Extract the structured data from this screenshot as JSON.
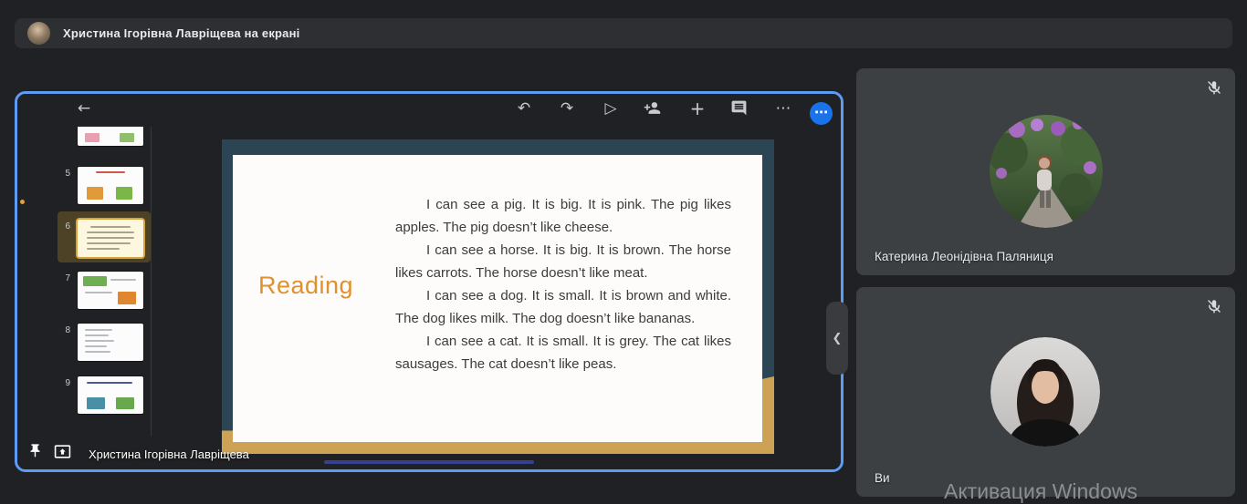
{
  "banner": {
    "text": "Христина Ігорівна Лавріщева на екрані"
  },
  "share": {
    "presenter_label": "Христина Ігорівна Лавріщева",
    "toolbar": {
      "back_glyph": "←",
      "undo_glyph": "↶",
      "redo_glyph": "↷",
      "present_glyph": "▷",
      "insert_glyph": "+",
      "more_glyph": "⋯",
      "overflow_glyph": "⋯"
    },
    "handle_glyph": "❮",
    "selected_slide": "6",
    "thumbnails": [
      "5",
      "6",
      "7",
      "8",
      "9"
    ],
    "slide": {
      "title": "Reading",
      "paragraphs": [
        "I can see a pig. It is big. It is pink. The pig likes apples. The pig doesn’t like cheese.",
        "I can see a horse. It is big. It is brown. The horse likes carrots. The horse doesn’t like meat.",
        "I can see a dog. It is small. It is brown and white. The dog likes milk. The dog doesn’t like bananas.",
        "I can see a cat. It is small. It is grey. The cat likes sausages. The cat doesn’t like peas."
      ]
    }
  },
  "participants": [
    {
      "name": "Катерина Леонідівна Паляниця",
      "muted": true
    },
    {
      "name": "Ви",
      "muted": true
    }
  ],
  "watermark": {
    "text": "Активация Windows"
  },
  "colors": {
    "accent_blue": "#5d9cf5",
    "slide_teal": "#2b4554",
    "slide_tan": "#cda255",
    "title_orange": "#e0912f",
    "selected_thumb": "#d7a43e",
    "tile_bg": "#3c4043"
  }
}
